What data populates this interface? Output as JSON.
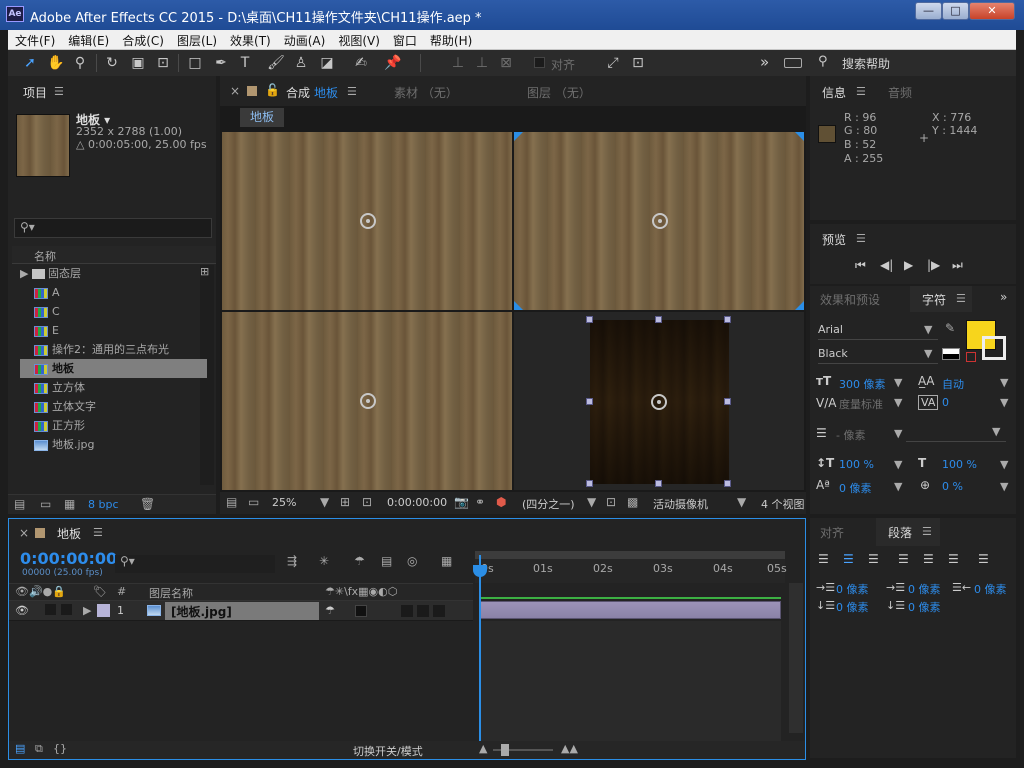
{
  "window": {
    "title": "Adobe After Effects CC 2015 - D:\\桌面\\CH11操作文件夹\\CH11操作.aep *",
    "logo": "Ae",
    "min": "—",
    "max": "□",
    "close": "✕"
  },
  "menu": [
    "文件(F)",
    "编辑(E)",
    "合成(C)",
    "图层(L)",
    "效果(T)",
    "动画(A)",
    "视图(V)",
    "窗口",
    "帮助(H)"
  ],
  "toolbar": {
    "snap_label": "对齐",
    "search_label": "搜索帮助",
    "more": "»"
  },
  "project": {
    "tab": "项目",
    "item_name": "地板 ▾",
    "item_dims": "2352 x 2788 (1.00)",
    "item_duration": "△ 0:00:05:00, 25.00 fps",
    "col_name": "名称",
    "items": [
      "固态层",
      "A",
      "C",
      "E",
      "操作2：通用的三点布光",
      "地板",
      "立方体",
      "立体文字",
      "正方形",
      "地板.jpg"
    ],
    "bpc": "8 bpc"
  },
  "comp": {
    "tab_prefix": "合成",
    "tab_name": "地板",
    "footage_tab": "素材 （无）",
    "layer_tab": "图层 （无）",
    "breadcrumb": "地板",
    "zoom": "25%",
    "time": "0:00:00:00",
    "view_res": "(四分之一)",
    "camera": "活动摄像机",
    "views": "4 个视图"
  },
  "info": {
    "tab": "信息",
    "audio_tab": "音频",
    "r": "R : 96",
    "g": "G : 80",
    "b": "B : 52",
    "a": "A : 255",
    "x": "X : 776",
    "y": "Y : 1444",
    "swatch": "#605034"
  },
  "preview": {
    "tab": "预览"
  },
  "character": {
    "effects_tab": "效果和预设",
    "tab": "字符",
    "font": "Arial",
    "style": "Black",
    "fill_color": "#f7d51c",
    "size": "300 像素",
    "leading": "自动",
    "kerning": "度量标准",
    "tracking": "0",
    "stroke": "- 像素",
    "vscale": "100 %",
    "hscale": "100 %",
    "baseline": "0 像素",
    "tsume": "0 %"
  },
  "paragraph": {
    "align_tab": "对齐",
    "tab": "段落",
    "indent_left": "0 像素",
    "indent_first": "0 像素",
    "indent_right": "0 像素",
    "space_before": "0 像素",
    "space_after": "0 像素"
  },
  "timeline": {
    "tab": "地板",
    "timecode": "0:00:00:00",
    "frames": "00000 (25.00 fps)",
    "col_num": "#",
    "col_name": "图层名称",
    "layer_num": "1",
    "layer_name": "[地板.jpg]",
    "ticks": [
      "0s",
      "01s",
      "02s",
      "03s",
      "04s",
      "05s"
    ],
    "toggle_label": "切换开关/模式"
  }
}
